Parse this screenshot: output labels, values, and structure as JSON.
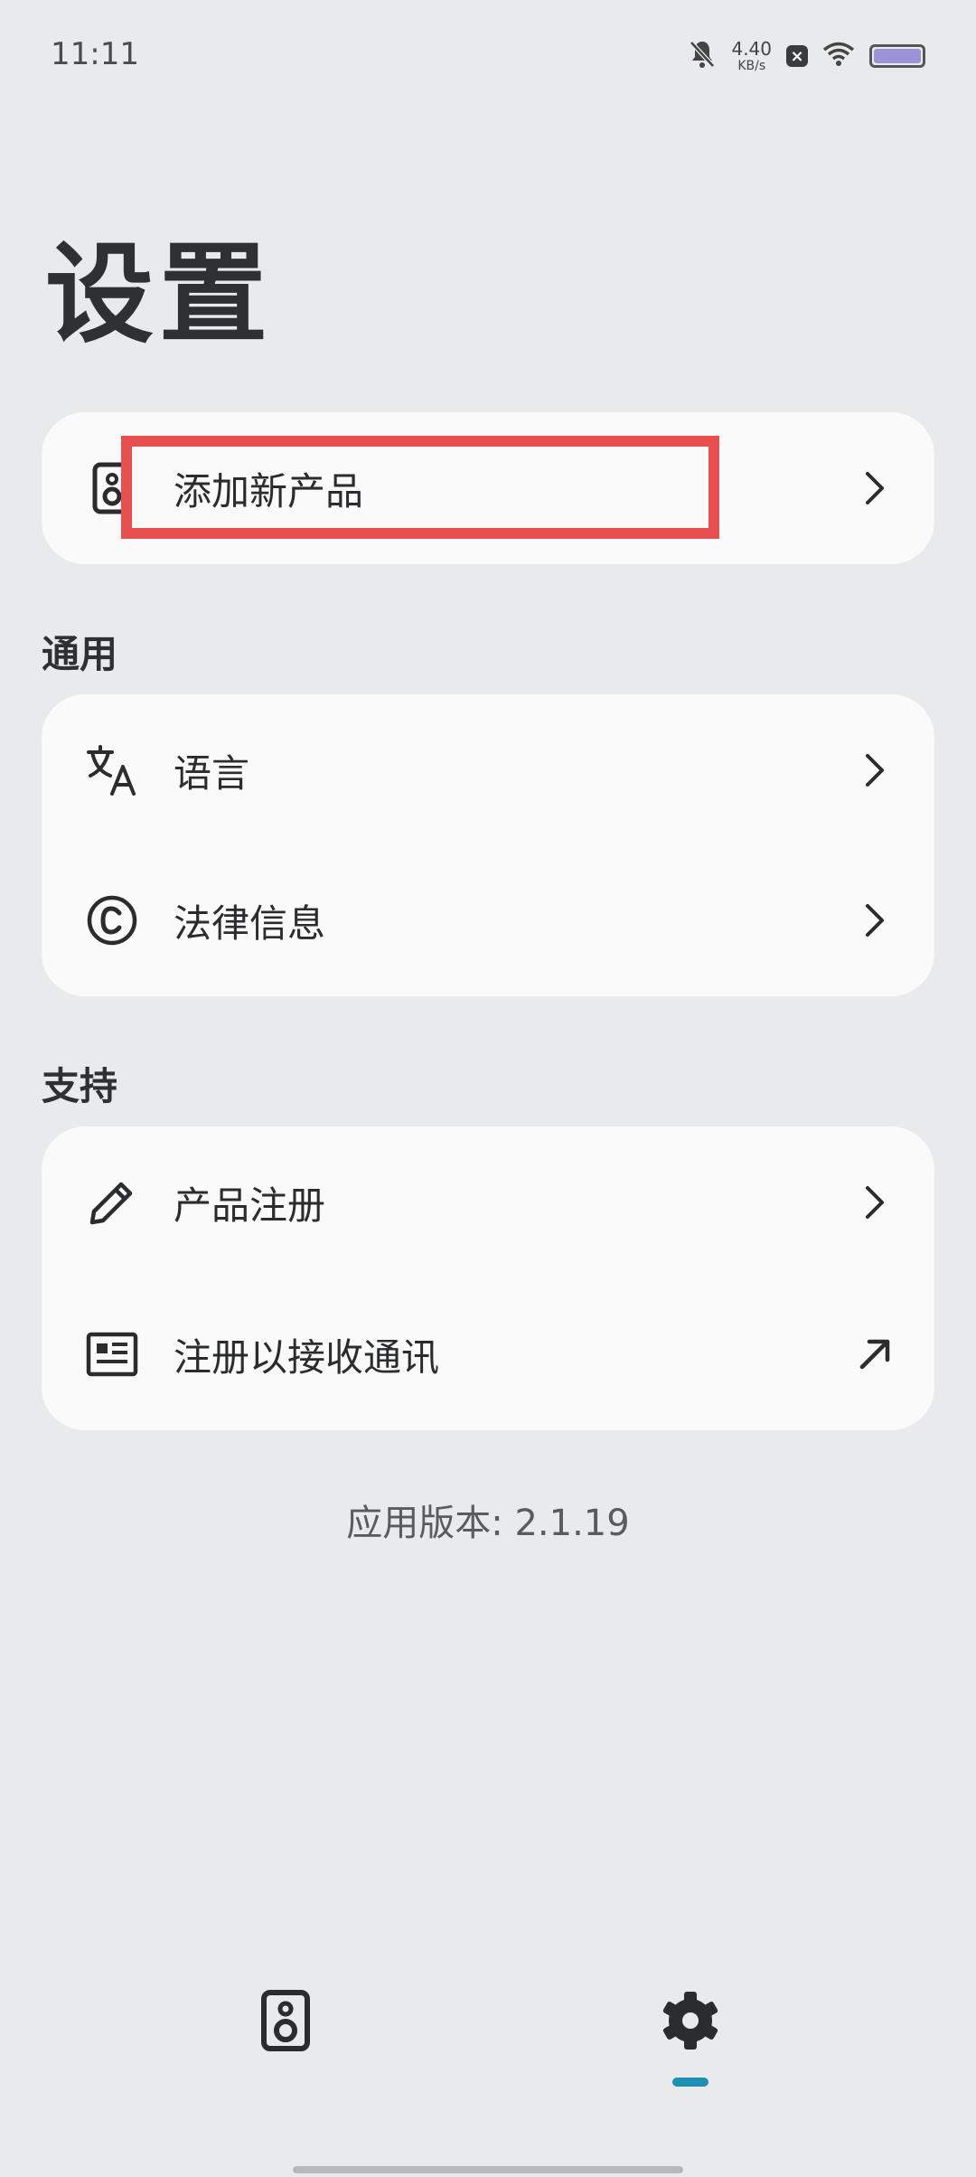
{
  "status_bar": {
    "time": "11:11",
    "net_speed_value": "4.40",
    "net_speed_unit": "KB/s"
  },
  "page_title": "设置",
  "add_product_card": {
    "label": "添加新产品"
  },
  "sections": {
    "general": {
      "title": "通用",
      "items": [
        {
          "label": "语言"
        },
        {
          "label": "法律信息"
        }
      ]
    },
    "support": {
      "title": "支持",
      "items": [
        {
          "label": "产品注册"
        },
        {
          "label": "注册以接收通讯"
        }
      ]
    }
  },
  "version": "应用版本: 2.1.19",
  "colors": {
    "background": "#e9eaec",
    "card": "#fafafa",
    "highlight": "#e8504f",
    "nav_active": "#1f8fb4"
  },
  "icons": [
    "speaker-icon",
    "chevron-right-icon",
    "translate-icon",
    "copyright-icon",
    "pencil-icon",
    "newsletter-icon",
    "external-arrow-icon",
    "gear-icon"
  ]
}
